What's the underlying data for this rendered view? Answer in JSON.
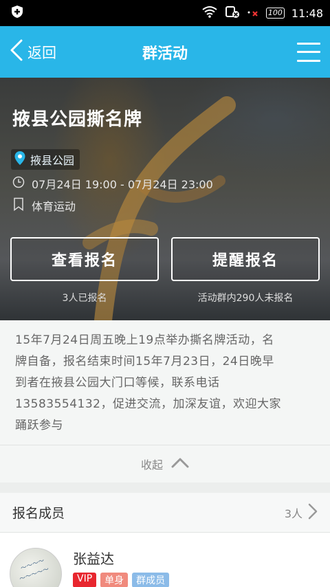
{
  "status": {
    "time": "11:48",
    "battery": "100"
  },
  "nav": {
    "back_label": "返回",
    "title": "群活动"
  },
  "event": {
    "title": "掖县公园撕名牌",
    "location": "掖县公园",
    "time": "07月24日 19:00 - 07月24日 23:00",
    "category": "体育运动"
  },
  "actions": {
    "view_signup": "查看报名",
    "remind_signup": "提醒报名",
    "signed_count": "3人已报名",
    "unsigned_count": "活动群内290人未报名"
  },
  "description": {
    "lines": [
      "15年7月24日周五晚上19点举办撕名牌活动，名",
      "牌自备，报名结束时间15年7月23日，24日晚早",
      "到者在掖县公园大门口等候，联系电话",
      "13583554132，促进交流，加深友谊，欢迎大家",
      "踊跃参与"
    ],
    "collapse_label": "收起"
  },
  "members": {
    "header": "报名成员",
    "count": "3人",
    "list": [
      {
        "name": "张益达",
        "tags": [
          "VIP",
          "单身",
          "群成员"
        ]
      }
    ]
  },
  "colors": {
    "brand": "#29b6e8",
    "vip": "#e8262e",
    "single": "#f08a7d",
    "member": "#8bbbe8"
  }
}
